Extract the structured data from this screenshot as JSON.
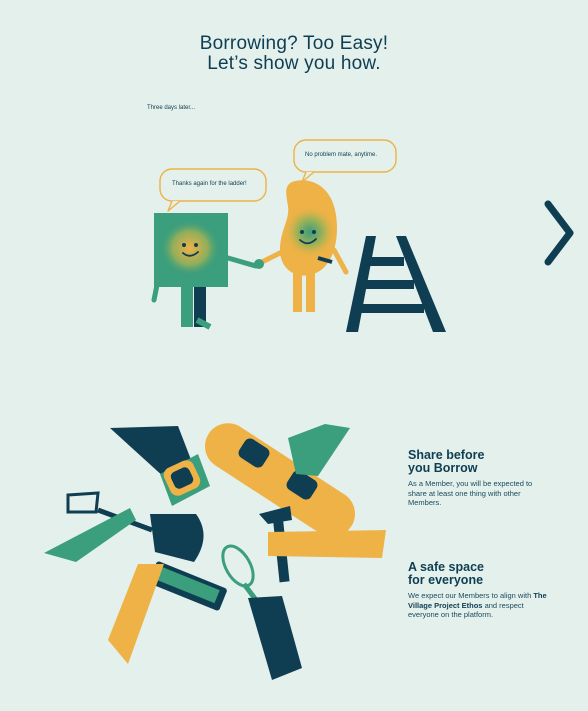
{
  "hero": {
    "title_line1": "Borrowing? Too Easy!",
    "title_line2": "Let’s show you how."
  },
  "story": {
    "caption": "Three days later...",
    "bubble_left": "Thanks again for the ladder!",
    "bubble_right": "No problem mate, anytime."
  },
  "features": [
    {
      "title_line1": "Share before",
      "title_line2": "you Borrow",
      "body": "As a Member, you will be expected to share at least one thing with other Members."
    },
    {
      "title_line1": "A safe space",
      "title_line2": "for everyone",
      "body_before": "We expect our Members to align with ",
      "body_bold": "The Village Project Ethos",
      "body_after": " and respect everyone on the platform."
    }
  ],
  "colors": {
    "background": "#e3f0ec",
    "navy": "#0f3e52",
    "green": "#3b9e7c",
    "yellow": "#eeb246"
  },
  "icons": [
    "chevron-right-icon"
  ]
}
